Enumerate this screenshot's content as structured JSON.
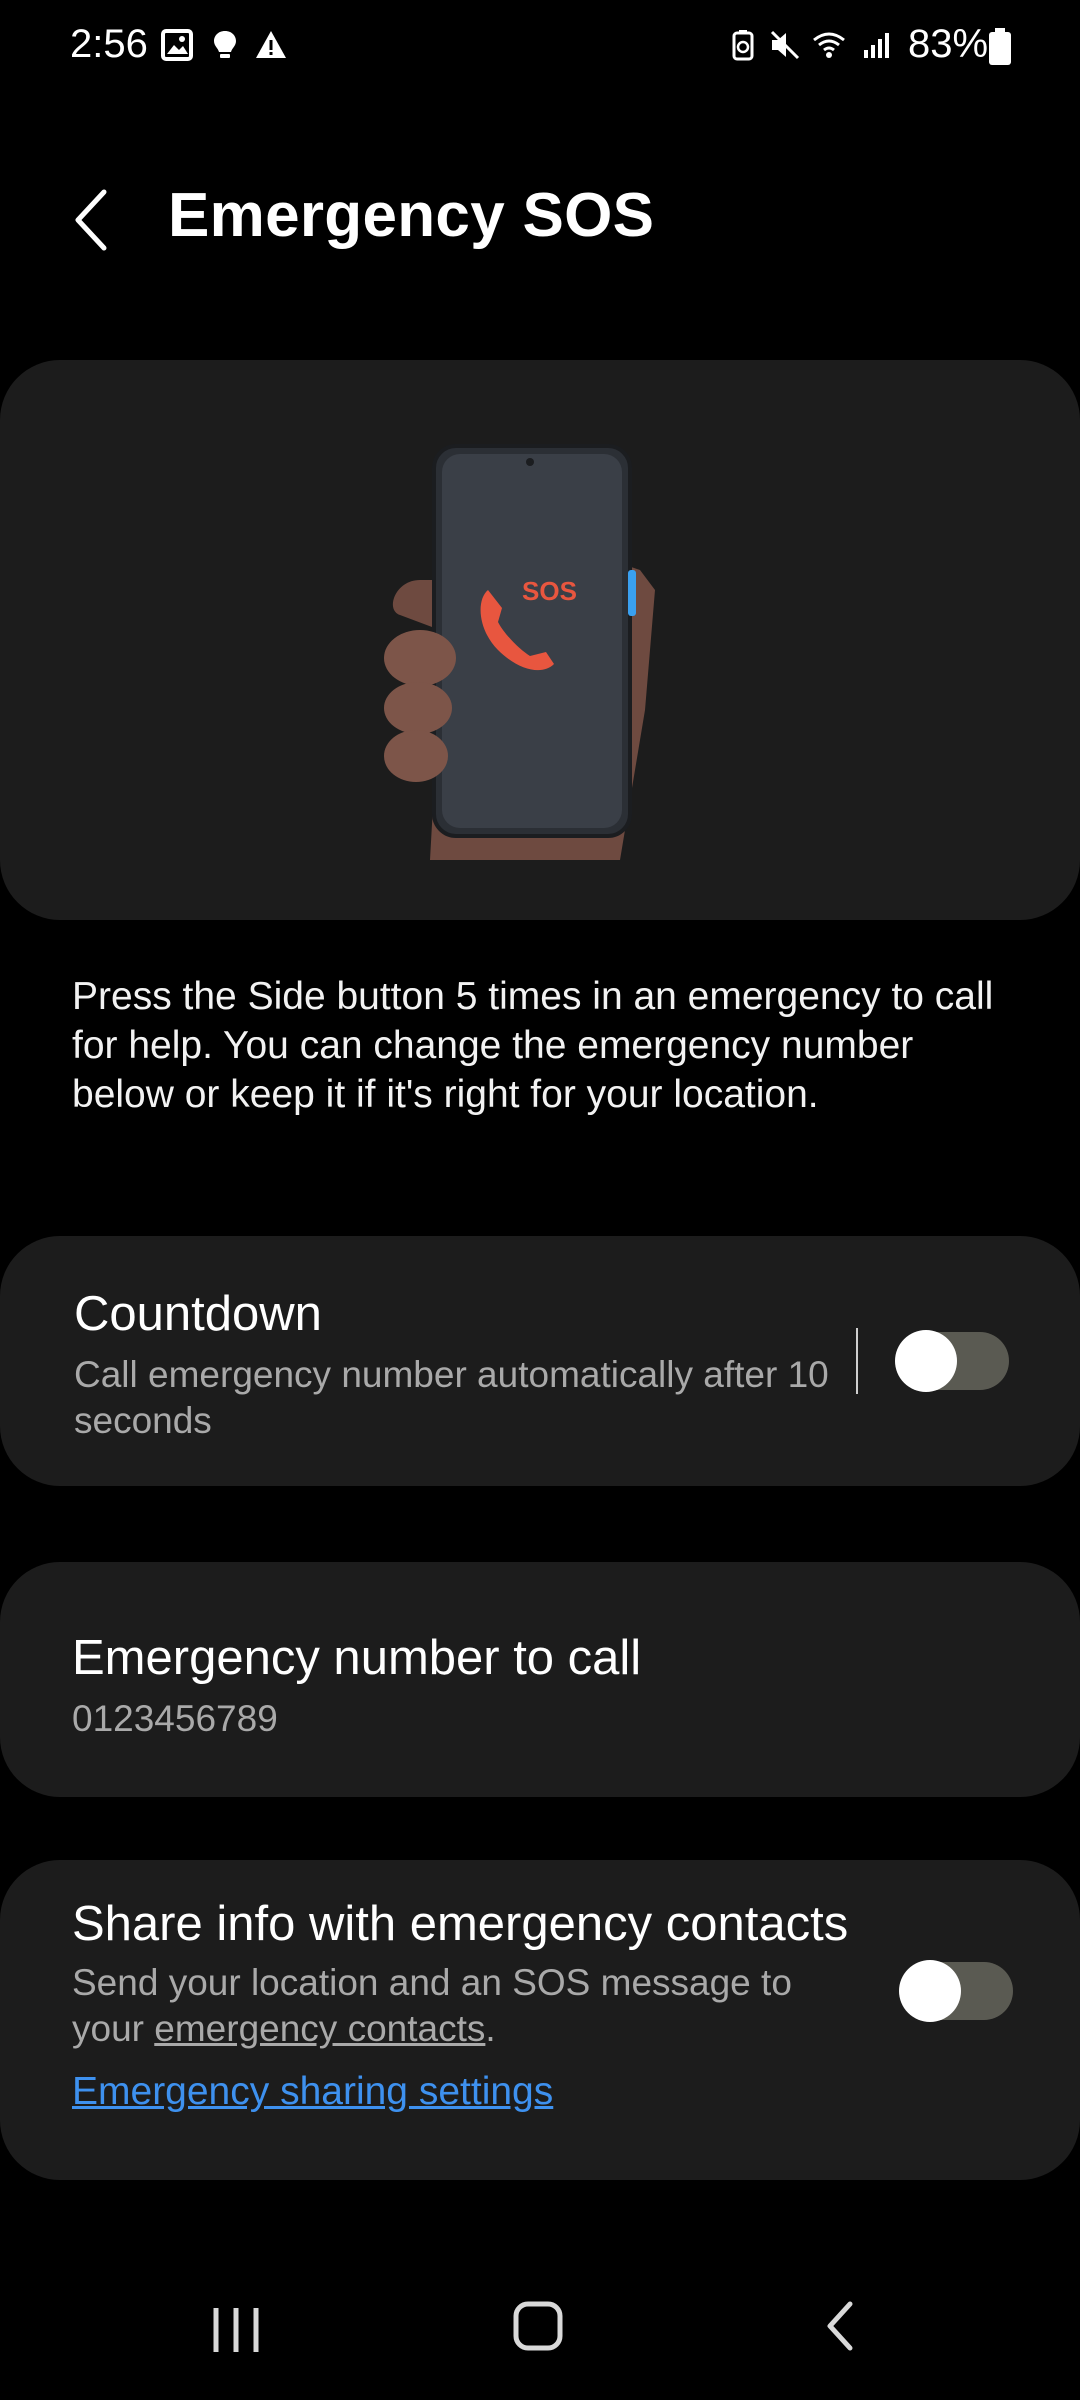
{
  "status_bar": {
    "time": "2:56",
    "battery": "83%",
    "icons": [
      "gallery-icon",
      "bulb-icon",
      "warning-icon",
      "battery-saver-icon",
      "mute-icon",
      "wifi-icon",
      "signal-icon",
      "battery-icon"
    ]
  },
  "header": {
    "title": "Emergency SOS"
  },
  "illustration": {
    "sos_text": "SOS"
  },
  "description": "Press the Side button 5 times in an emergency to call for help. You can change the emergency number below or keep it if it's right for your location.",
  "countdown": {
    "title": "Countdown",
    "subtitle": "Call emergency number automatically after 10 seconds",
    "enabled": false
  },
  "emergency_number": {
    "title": "Emergency number to call",
    "value": "0123456789"
  },
  "share_info": {
    "title": "Share info with emergency contacts",
    "subtitle_prefix": "Send your location and an SOS message to your ",
    "subtitle_link": "emergency contacts",
    "subtitle_suffix": ".",
    "settings_link": "Emergency sharing settings",
    "enabled": false
  },
  "colors": {
    "accent_link": "#3e91ef",
    "card_bg": "#1c1c1c",
    "sos_red": "#e8563f"
  }
}
